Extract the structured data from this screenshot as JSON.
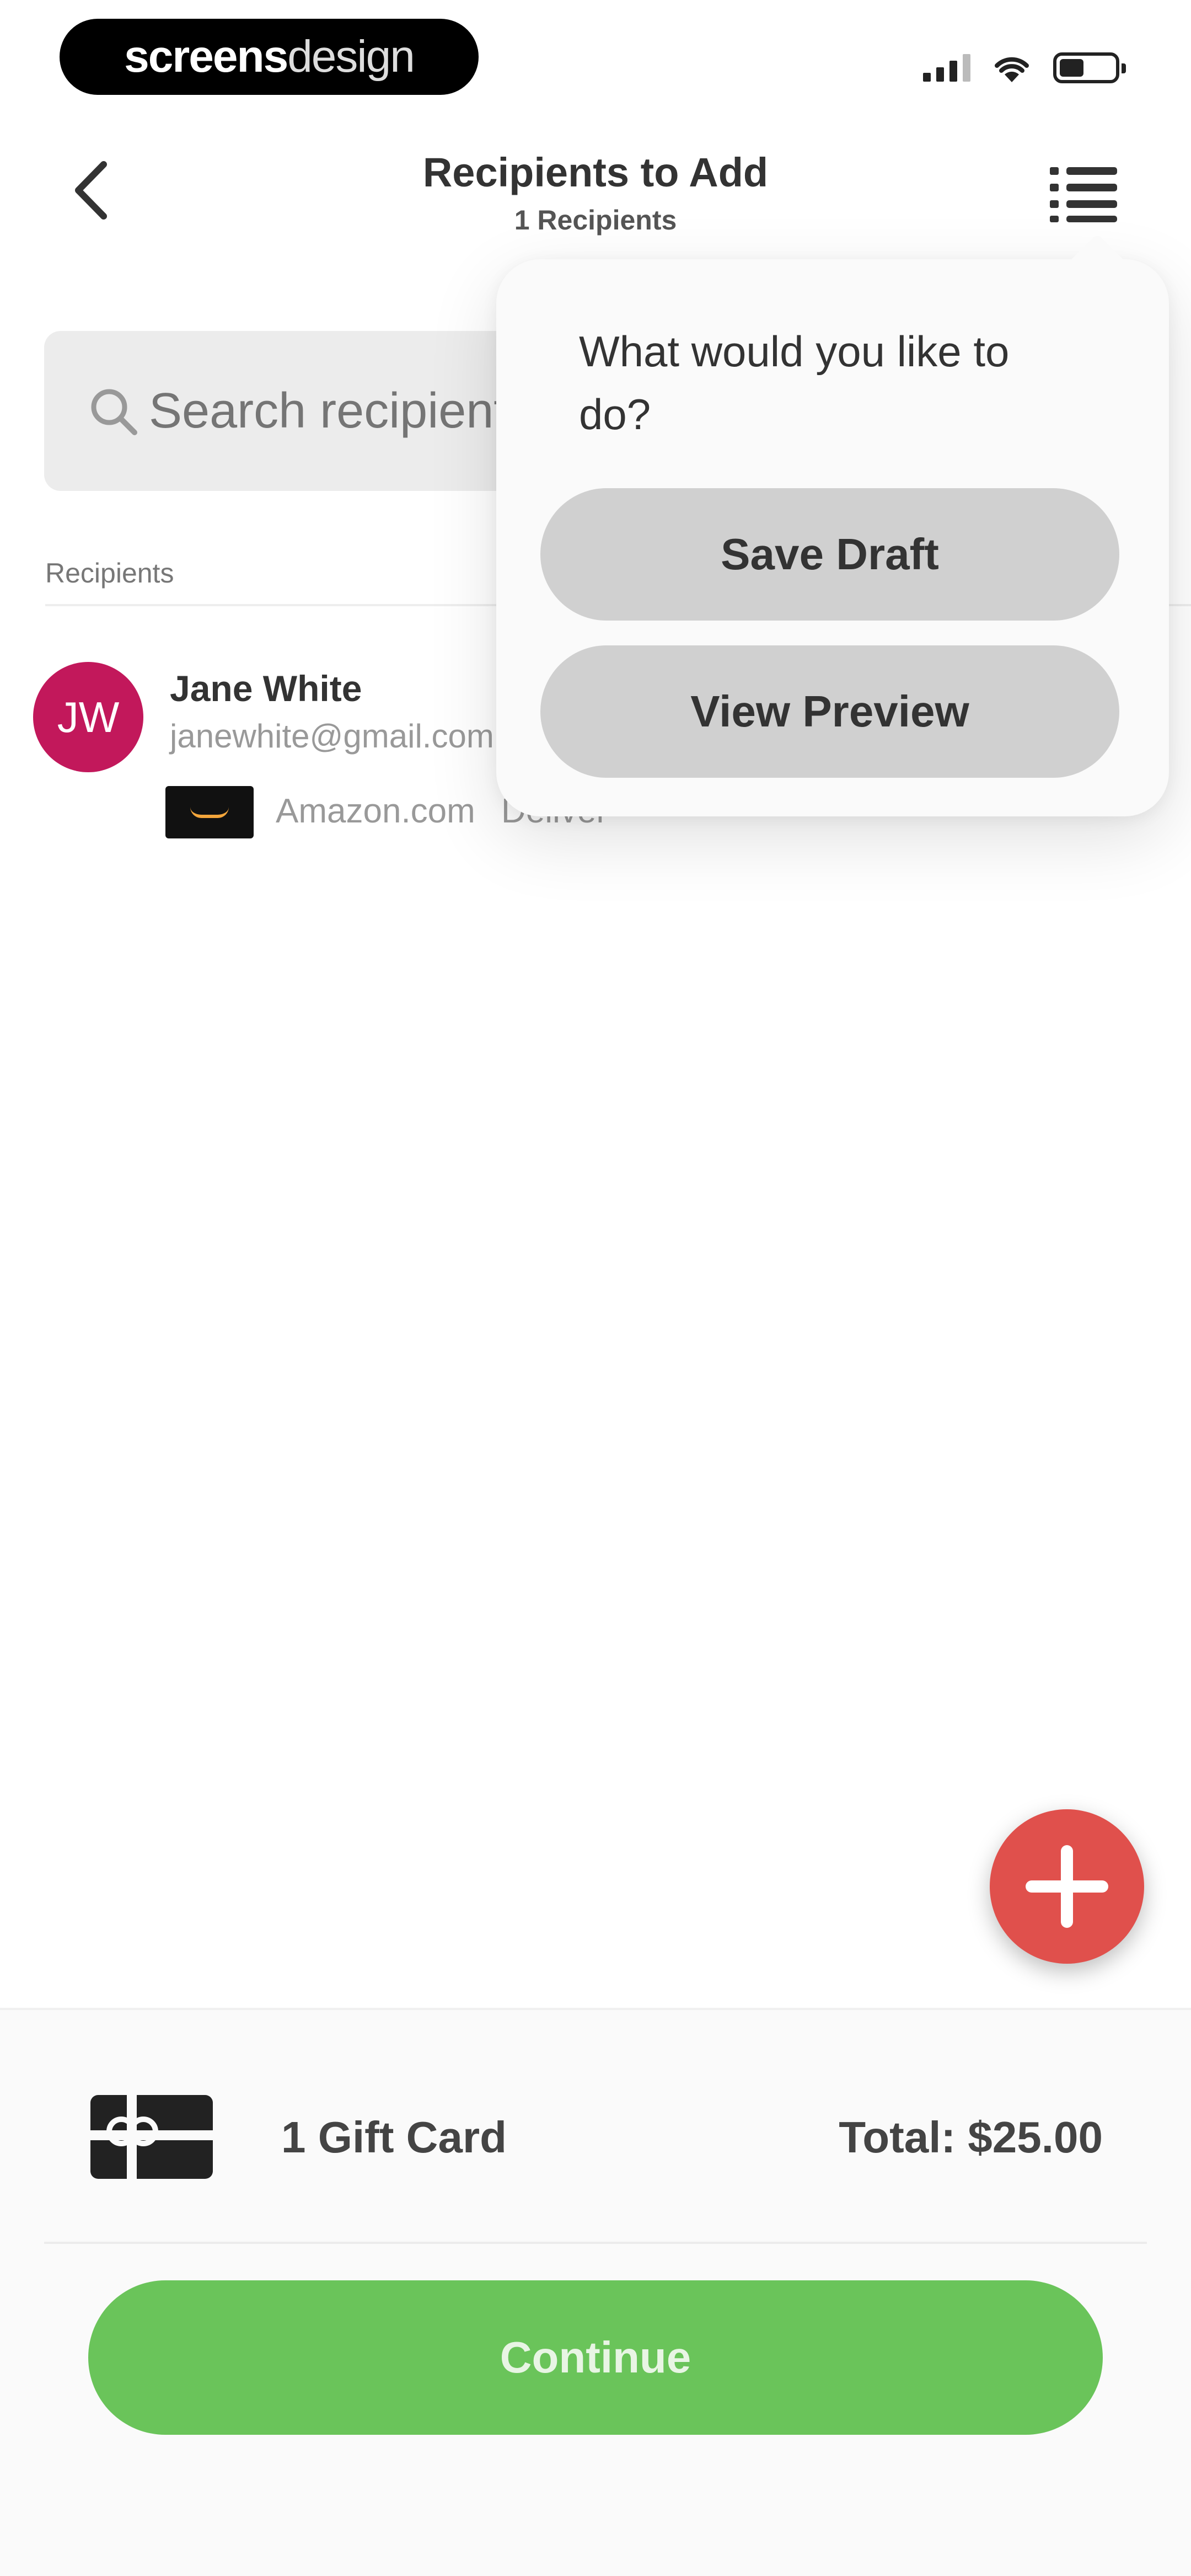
{
  "status_bar": {
    "brand_bold": "screens",
    "brand_light": "design"
  },
  "nav": {
    "title": "Recipients to Add",
    "subtitle": "1 Recipients"
  },
  "search": {
    "placeholder": "Search recipients"
  },
  "recipients_section": {
    "label": "Recipients"
  },
  "recipients": [
    {
      "initials": "JW",
      "name": "Jane White",
      "email": "janewhite@gmail.com",
      "card_brand": "Amazon.com",
      "card_detail": "Deliver",
      "avatar_color": "#c2185b"
    }
  ],
  "popover": {
    "title": "What would you like to do?",
    "save_label": "Save Draft",
    "preview_label": "View Preview"
  },
  "summary": {
    "count_label": "1 Gift Card",
    "total_label": "Total: $25.00"
  },
  "continue_label": "Continue",
  "colors": {
    "accent_green": "#6ac45a",
    "fab_red": "#e0504c",
    "avatar": "#c2185b"
  }
}
